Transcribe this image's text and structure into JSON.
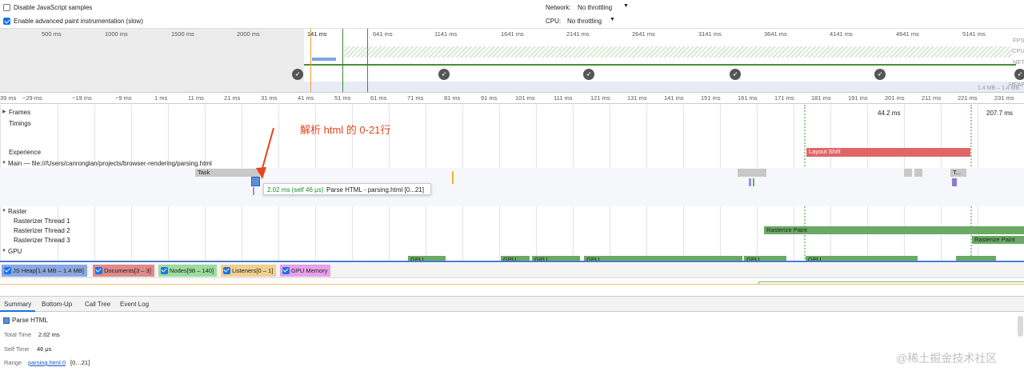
{
  "settings": {
    "disable_js_samples": "Disable JavaScript samples",
    "enable_paint": "Enable advanced paint instrumentation (slow)",
    "network_label": "Network:",
    "network_value": "No throttling",
    "cpu_label": "CPU:",
    "cpu_value": "No throttling"
  },
  "overview": {
    "ticks": [
      "500 ms",
      "1000 ms",
      "1500 ms",
      "2000 ms",
      "141 ms",
      "641 ms",
      "1141 ms",
      "1641 ms",
      "2141 ms",
      "2641 ms",
      "3141 ms",
      "3641 ms",
      "4141 ms",
      "4641 ms",
      "5141 ms"
    ],
    "labels": [
      "FPS",
      "CPU",
      "NET",
      "HEAP"
    ],
    "heap_range": "1.4 MB – 1.4 MB"
  },
  "ruler": {
    "ticks": [
      "39 ms",
      "−29 ms",
      "−19 ms",
      "−9 ms",
      "1 ms",
      "11 ms",
      "21 ms",
      "31 ms",
      "41 ms",
      "51 ms",
      "61 ms",
      "71 ms",
      "81 ms",
      "91 ms",
      "101 ms",
      "111 ms",
      "121 ms",
      "131 ms",
      "141 ms",
      "151 ms",
      "161 ms",
      "171 ms",
      "181 ms",
      "191 ms",
      "201 ms",
      "211 ms",
      "221 ms",
      "231 ms"
    ]
  },
  "tracks": {
    "frames": "Frames",
    "frames_time_1": "44.2 ms",
    "frames_time_2": "207.7 ms",
    "timings": "Timings",
    "experience": "Experience",
    "layout_shift": "Layout Shift",
    "main": "Main — file:///Users/canronglan/projects/browser-rendering/parsing.html",
    "task": "Task",
    "task_short": "T...",
    "raster": "Raster",
    "rasterizer_1": "Rasterizer Thread 1",
    "rasterizer_2": "Rasterizer Thread 2",
    "rasterizer_3": "Rasterizer Thread 3",
    "rasterize_paint": "Rasterize Paint",
    "gpu": "GPU",
    "gpu_bar": "GPU"
  },
  "tooltip": {
    "time": "2.02 ms (self 46 μs)",
    "text": "Parse HTML - parsing.html [0...21]"
  },
  "annotation": {
    "text": "解析 html 的 0-21行"
  },
  "legend": {
    "js_heap": "JS Heap[1.4 MB – 1.4 MB]",
    "documents": "Documents[3 – 3]",
    "nodes": "Nodes[98 – 140]",
    "listeners": "Listeners[0 – 1]",
    "gpu_memory": "GPU Memory"
  },
  "tabs": [
    "Summary",
    "Bottom-Up",
    "Call Tree",
    "Event Log"
  ],
  "summary": {
    "title": "Parse HTML",
    "total_time_label": "Total Time",
    "total_time_value": "2.02 ms",
    "self_time_label": "Self Time",
    "self_time_value": "46 μs",
    "range_label": "Range",
    "range_link": "parsing.html:0",
    "range_suffix": "[0…21]"
  },
  "watermark": "@稀土掘金技术社区",
  "colors": {
    "accent": "#1a73e8",
    "layout_shift": "#e06666",
    "raster": "#6aaa64",
    "task": "#c8c8c8",
    "parse_html": "#5b8fd6",
    "annotation": "#e8431a"
  }
}
